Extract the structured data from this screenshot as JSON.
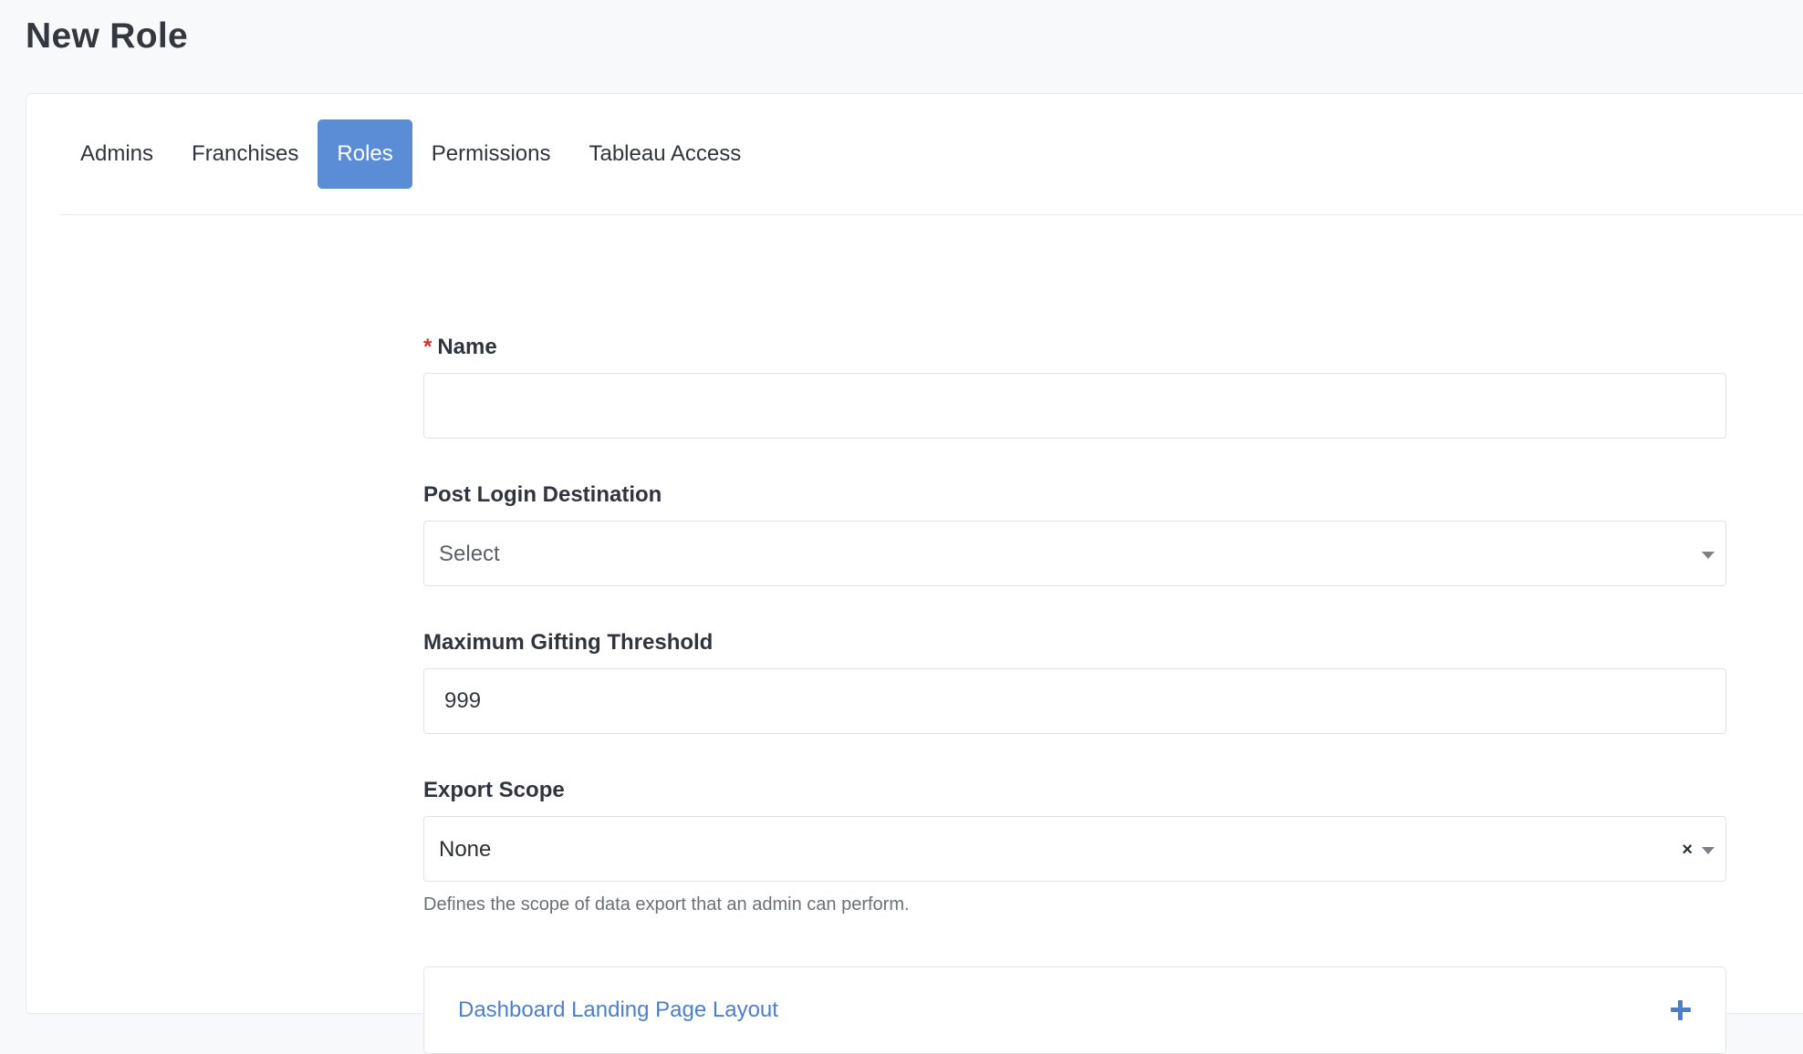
{
  "page": {
    "title": "New Role"
  },
  "tabs": [
    {
      "label": "Admins",
      "active": false
    },
    {
      "label": "Franchises",
      "active": false
    },
    {
      "label": "Roles",
      "active": true
    },
    {
      "label": "Permissions",
      "active": false
    },
    {
      "label": "Tableau Access",
      "active": false
    }
  ],
  "form": {
    "name": {
      "required_mark": "*",
      "label": "Name",
      "value": "",
      "placeholder": ""
    },
    "post_login_destination": {
      "label": "Post Login Destination",
      "selected": "Select",
      "icon": "chevron-down-icon"
    },
    "max_gifting_threshold": {
      "label": "Maximum Gifting Threshold",
      "value": "999"
    },
    "export_scope": {
      "label": "Export Scope",
      "selected": "None",
      "clear_symbol": "×",
      "help": "Defines the scope of data export that an admin can perform.",
      "icon": "chevron-down-icon"
    },
    "dashboard_panel": {
      "title": "Dashboard Landing Page Layout",
      "icon": "plus-icon"
    }
  },
  "colors": {
    "accent": "#5a8dd6",
    "link": "#4a7fcf",
    "required": "#d93025",
    "background": "#f8f9fb"
  }
}
